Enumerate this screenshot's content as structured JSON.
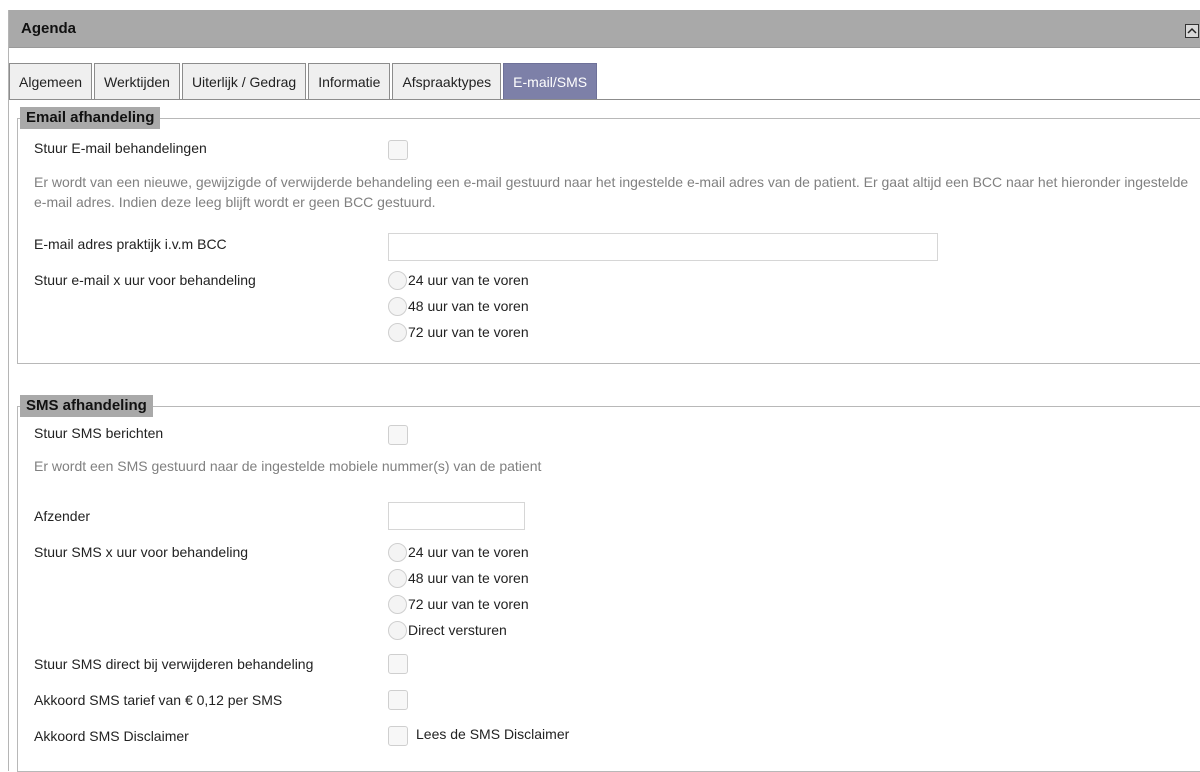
{
  "header": {
    "title": "Agenda"
  },
  "tabs": [
    {
      "label": "Algemeen",
      "active": false
    },
    {
      "label": "Werktijden",
      "active": false
    },
    {
      "label": "Uiterlijk / Gedrag",
      "active": false
    },
    {
      "label": "Informatie",
      "active": false
    },
    {
      "label": "Afspraaktypes",
      "active": false
    },
    {
      "label": "E-mail/SMS",
      "active": true
    }
  ],
  "email": {
    "legend": "Email afhandeling",
    "send_label": "Stuur E-mail behandelingen",
    "description": "Er wordt van een nieuwe, gewijzigde of verwijderde behandeling een e-mail gestuurd naar het ingestelde e-mail adres van de patient. Er gaat altijd een BCC naar het hieronder ingestelde e-mail adres. Indien deze leeg blijft wordt er geen BCC gestuurd.",
    "bcc_label": "E-mail adres praktijk i.v.m BCC",
    "bcc_value": "",
    "timing_label": "Stuur e-mail x uur voor behandeling",
    "options": [
      "24 uur van te voren",
      "48 uur van te voren",
      "72 uur van te voren"
    ]
  },
  "sms": {
    "legend": "SMS afhandeling",
    "send_label": "Stuur SMS berichten",
    "description": "Er wordt een SMS gestuurd naar de ingestelde mobiele nummer(s) van de patient",
    "sender_label": "Afzender",
    "sender_value": "",
    "timing_label": "Stuur SMS x uur voor behandeling",
    "options": [
      "24 uur van te voren",
      "48 uur van te voren",
      "72 uur van te voren",
      "Direct versturen"
    ],
    "delete_label": "Stuur SMS direct bij verwijderen behandeling",
    "tariff_label": "Akkoord SMS tarief van € 0,12 per SMS",
    "disclaimer_label": "Akkoord SMS Disclaimer",
    "disclaimer_link": "Lees de SMS Disclaimer"
  },
  "colors": {
    "header_bg": "#a9a9a9",
    "active_tab": "#7d80a8",
    "muted_text": "#808080"
  },
  "icons": {
    "collapse": "chevron-up-icon"
  }
}
